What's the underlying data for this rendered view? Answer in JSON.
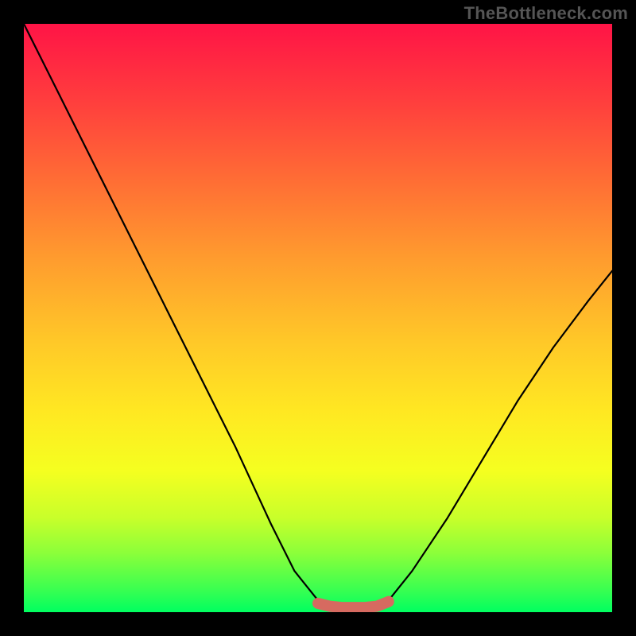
{
  "watermark": {
    "text": "TheBottleneck.com"
  },
  "gradient": {
    "top": "#ff1446",
    "bottom": "#00ff60"
  },
  "chart_data": {
    "type": "line",
    "title": "",
    "xlabel": "",
    "ylabel": "",
    "xlim": [
      0,
      100
    ],
    "ylim": [
      0,
      100
    ],
    "grid": false,
    "series": [
      {
        "name": "bottleneck-curve",
        "x": [
          0,
          6,
          12,
          18,
          24,
          30,
          36,
          42,
          46,
          50,
          54,
          58,
          62,
          66,
          72,
          78,
          84,
          90,
          96,
          100
        ],
        "values": [
          100,
          88,
          76,
          64,
          52,
          40,
          28,
          15,
          7,
          2,
          0,
          0,
          2,
          7,
          16,
          26,
          36,
          45,
          53,
          58
        ]
      },
      {
        "name": "flat-zone-marker",
        "x": [
          50,
          52,
          54,
          56,
          58,
          60,
          62
        ],
        "values": [
          1.5,
          1.0,
          0.8,
          0.8,
          0.8,
          1.0,
          1.8
        ]
      }
    ],
    "annotations": []
  }
}
